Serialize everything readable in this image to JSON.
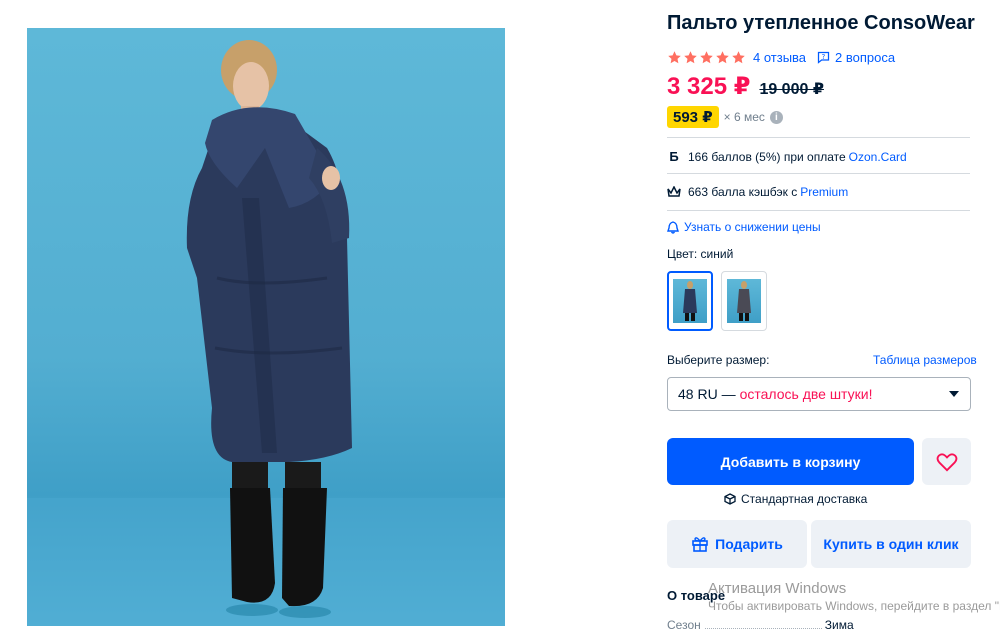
{
  "product": {
    "title": "Пальто утепленное ConsoWear",
    "rating": 5,
    "reviews_label": "4 отзыва",
    "questions_label": "2 вопроса",
    "price": "3 325 ₽",
    "old_price": "19 000 ₽",
    "installment_amount": "593 ₽",
    "installment_term": "× 6 мес"
  },
  "bonuses": {
    "card_prefix": "166 баллов (5%) при оплате ",
    "card_link": "Ozon.Card",
    "premium_prefix": "663 балла кэшбэк с ",
    "premium_link": "Premium"
  },
  "notify_label": "Узнать о снижении цены",
  "color_label": "Цвет: синий",
  "size": {
    "label": "Выберите размер:",
    "table_link": "Таблица размеров",
    "selected": "48 RU —",
    "stock_note": "осталось две штуки!"
  },
  "actions": {
    "add_to_cart": "Добавить в корзину",
    "delivery": "Стандартная доставка",
    "gift": "Подарить",
    "one_click": "Купить в один клик"
  },
  "about": {
    "heading": "О товаре",
    "season_key": "Сезон",
    "season_value": "Зима"
  },
  "watermark": {
    "title": "Активация Windows",
    "subtitle": "Чтобы активировать Windows, перейдите в раздел \"Па"
  },
  "colors": {
    "accent": "#005bff",
    "price": "#f91155",
    "star": "#ff6f61",
    "badge": "#ffd600"
  }
}
